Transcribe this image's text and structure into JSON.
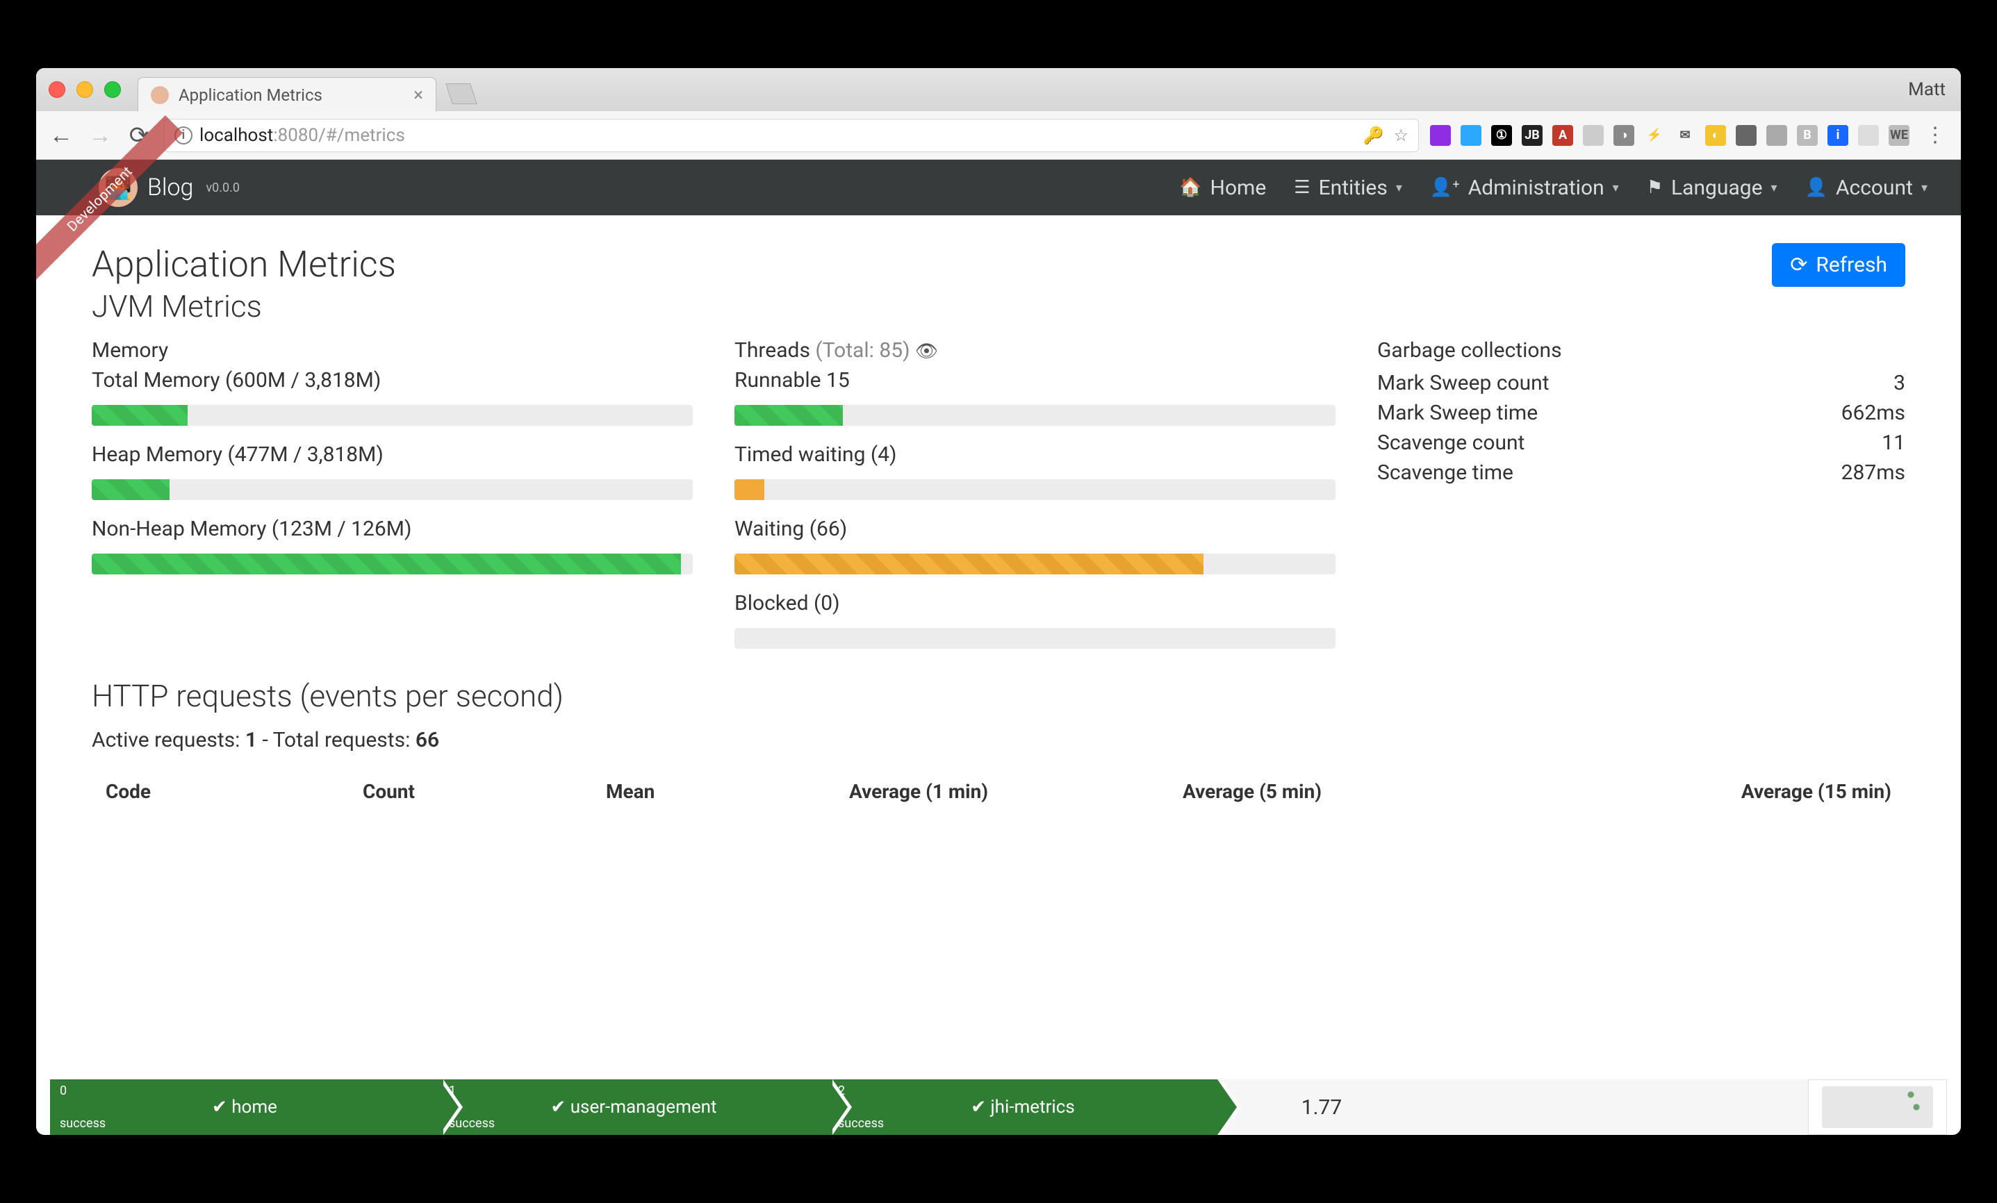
{
  "browser": {
    "profile": "Matt",
    "tab_title": "Application Metrics",
    "url_host": "localhost",
    "url_port": ":8080",
    "url_path": "/#/metrics"
  },
  "nav": {
    "ribbon": "Development",
    "brand": "Blog",
    "version": "v0.0.0",
    "links": {
      "home": "Home",
      "entities": "Entities",
      "administration": "Administration",
      "language": "Language",
      "account": "Account"
    }
  },
  "page": {
    "title": "Application Metrics",
    "subtitle": "JVM Metrics",
    "refresh": "Refresh"
  },
  "memory": {
    "header": "Memory",
    "total_label": "Total Memory (600M / 3,818M)",
    "total_pct": 16,
    "heap_label": "Heap Memory (477M / 3,818M)",
    "heap_pct": 13,
    "nonheap_label": "Non-Heap Memory (123M / 126M)",
    "nonheap_pct": 98
  },
  "threads": {
    "header": "Threads",
    "total_label": "(Total: 85)",
    "runnable_label": "Runnable 15",
    "runnable_pct": 18,
    "timed_label": "Timed waiting (4)",
    "timed_pct": 5,
    "waiting_label": "Waiting (66)",
    "waiting_pct": 78,
    "blocked_label": "Blocked (0)",
    "blocked_pct": 0
  },
  "gc": {
    "header": "Garbage collections",
    "rows": [
      {
        "k": "Mark Sweep count",
        "v": "3"
      },
      {
        "k": "Mark Sweep time",
        "v": "662ms"
      },
      {
        "k": "Scavenge count",
        "v": "11"
      },
      {
        "k": "Scavenge time",
        "v": "287ms"
      }
    ]
  },
  "http": {
    "header": "HTTP requests (events per second)",
    "sub_prefix": "Active requests: ",
    "active": "1",
    "sub_mid": " - Total requests: ",
    "total": "66",
    "columns": {
      "c1": "Code",
      "c2": "Count",
      "c3": "Mean",
      "c4": "Average (1 min)",
      "c5": "Average (5 min)",
      "c6": "Average (15 min)"
    },
    "avg5_value": "1.77"
  },
  "crumbs": [
    {
      "idx": "0",
      "status": "success",
      "label": "home"
    },
    {
      "idx": "1",
      "status": "success",
      "label": "user-management"
    },
    {
      "idx": "2",
      "status": "success",
      "label": "jhi-metrics"
    }
  ]
}
